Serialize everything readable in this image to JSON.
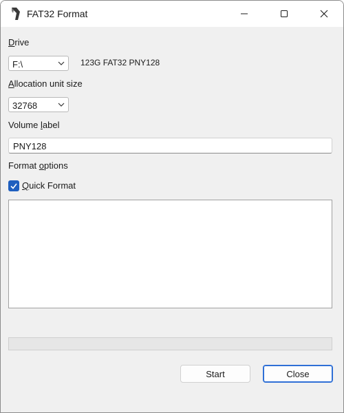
{
  "window": {
    "title": "FAT32 Format",
    "icons": {
      "app": "fat32format-app-icon",
      "minimize": "minimize-icon",
      "maximize": "maximize-icon",
      "close": "close-icon"
    }
  },
  "drive": {
    "label_accel": "D",
    "label_rest": "rive",
    "selected": "F:\\",
    "info": "123G FAT32 PNY128"
  },
  "allocation": {
    "label_accel": "A",
    "label_rest": "llocation unit size",
    "selected": "32768"
  },
  "volume_label": {
    "label_pre": "Volume ",
    "label_accel": "l",
    "label_post": "abel",
    "value": "PNY128"
  },
  "format_options": {
    "label_pre": "Format ",
    "label_accel": "o",
    "label_post": "ptions",
    "quick_format_accel": "Q",
    "quick_format_rest": "uick Format",
    "quick_format_checked": true
  },
  "progress": {
    "value": 0
  },
  "buttons": {
    "start": "Start",
    "close": "Close"
  },
  "colors": {
    "accent": "#1f5fbf",
    "default_button_border": "#2e6fd6"
  }
}
